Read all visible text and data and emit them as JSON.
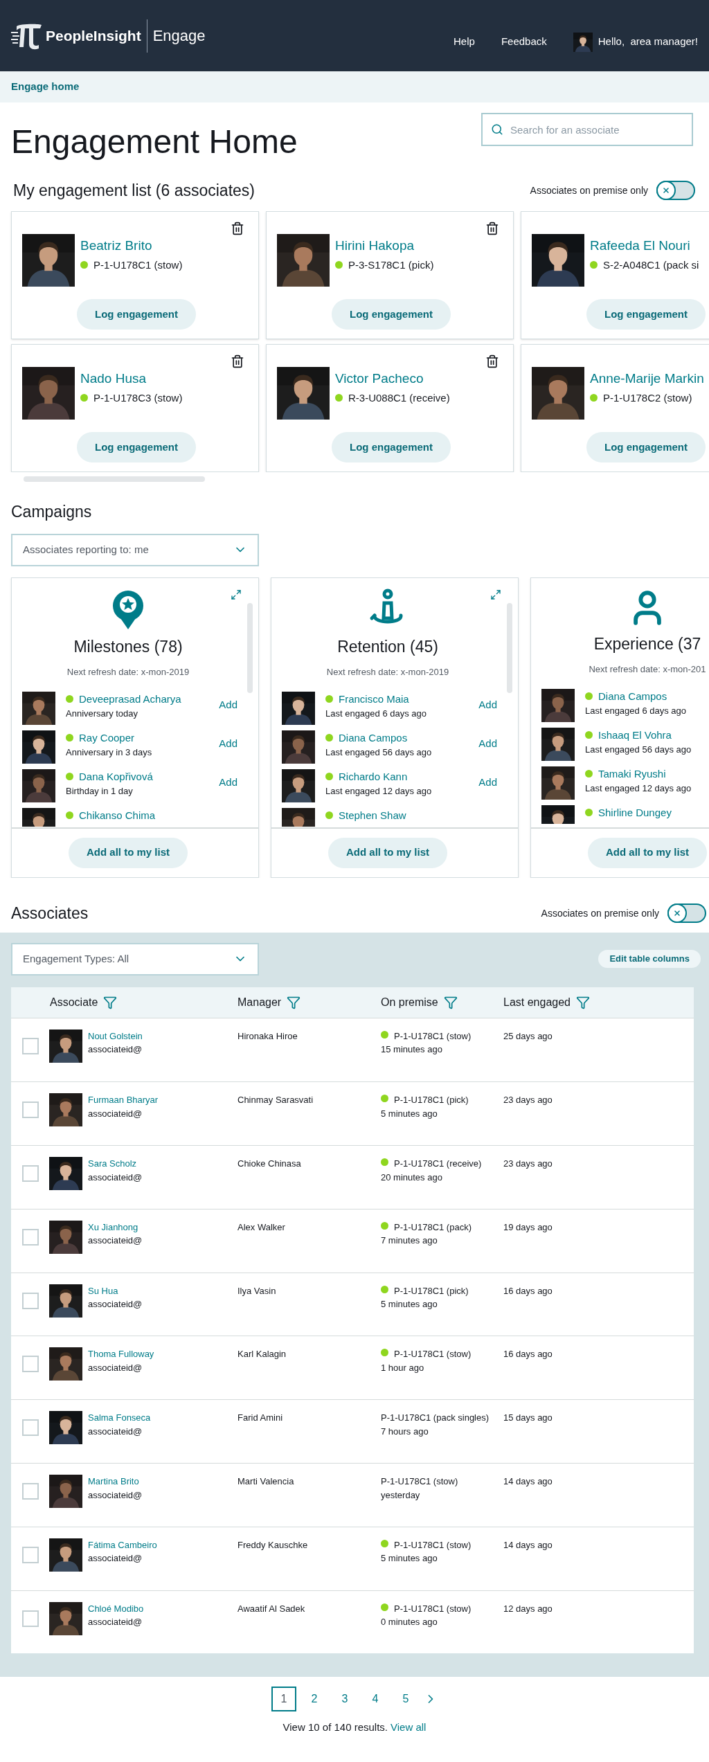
{
  "header": {
    "brand": "PeopleInsight",
    "product": "Engage",
    "nav": [
      "Help",
      "Feedback"
    ],
    "greeting": "Hello,  area manager!"
  },
  "breadcrumb": "Engage home",
  "title": "Engagement Home",
  "search": {
    "placeholder": "Search for an associate"
  },
  "engagement_list": {
    "heading": "My engagement list (6 associates)",
    "toggle": {
      "label": "Associates on premise only",
      "on": false
    },
    "cards": [
      {
        "name": "Beatriz Brito",
        "location": "P-1-U178C1 (stow)",
        "button": "Log engagement",
        "deletable": true
      },
      {
        "name": "Hirini Hakopa",
        "location": "P-3-S178C1 (pick)",
        "button": "Log engagement",
        "deletable": true
      },
      {
        "name": "Rafeeda El Nouri",
        "location": "S-2-A048C1 (pack si",
        "button": "Log engagement",
        "deletable": false
      },
      {
        "name": "Nado Husa",
        "location": "P-1-U178C3 (stow)",
        "button": "Log engagement",
        "deletable": true
      },
      {
        "name": "Victor Pacheco",
        "location": "R-3-U088C1 (receive)",
        "button": "Log engagement",
        "deletable": true
      },
      {
        "name": "Anne-Marije Markin",
        "location": "P-1-U178C2 (stow)",
        "button": "Log engagement",
        "deletable": false
      }
    ]
  },
  "campaigns": {
    "heading": "Campaigns",
    "filter": "Associates reporting to: me",
    "cards": [
      {
        "kind": "milestones",
        "title": "Milestones (78)",
        "refresh": "Next refresh date: x-mon-2019",
        "expandable": true,
        "button": "Add all to my list",
        "people": [
          {
            "name": "Deveeprasad Acharya",
            "note": "Anniversary today",
            "action": "Add"
          },
          {
            "name": "Ray Cooper",
            "note": "Anniversary in 3 days",
            "action": "Add"
          },
          {
            "name": "Dana Kopřivová",
            "note": "Birthday in 1 day",
            "action": "Add"
          },
          {
            "name": "Chikanso Chima"
          }
        ]
      },
      {
        "kind": "retention",
        "title": "Retention (45)",
        "refresh": "Next refresh date: x-mon-2019",
        "expandable": true,
        "button": "Add all to my list",
        "people": [
          {
            "name": "Francisco Maia",
            "note": "Last engaged 6 days ago",
            "action": "Add"
          },
          {
            "name": "Diana Campos",
            "note": "Last engaged 56 days ago",
            "action": "Add"
          },
          {
            "name": "Richardo Kann",
            "note": "Last engaged 12 days ago",
            "action": "Add"
          },
          {
            "name": "Stephen Shaw"
          }
        ]
      },
      {
        "kind": "experience",
        "title": "Experience (37",
        "refresh": "Next refresh date: x-mon-201",
        "expandable": false,
        "button": "Add all to my list",
        "people": [
          {
            "name": "Diana Campos",
            "note": "Last engaged 6 days ago"
          },
          {
            "name": "Ishaaq El Vohra",
            "note": "Last engaged 56 days ago"
          },
          {
            "name": "Tamaki Ryushi",
            "note": "Last engaged 12 days ago"
          },
          {
            "name": "Shirline Dungey"
          }
        ]
      }
    ]
  },
  "associates": {
    "heading": "Associates",
    "toggle": {
      "label": "Associates on premise only",
      "on": false
    },
    "filter": "Engagement Types: All",
    "edit_button": "Edit table columns",
    "columns": [
      "Associate",
      "Manager",
      "On premise",
      "Last engaged"
    ],
    "rows": [
      {
        "name": "Nout Golstein",
        "id": "associateid@",
        "manager": "Hironaka Hiroe",
        "location": "P-1-U178C1 (stow)",
        "seen": "15 minutes ago",
        "present": true,
        "last": "25 days ago",
        "checked": false
      },
      {
        "name": "Furmaan Bharyar",
        "id": "associateid@",
        "manager": "Chinmay Sarasvati",
        "location": "P-1-U178C1 (pick)",
        "seen": "5 minutes ago",
        "present": true,
        "last": "23 days ago",
        "checked": false
      },
      {
        "name": "Sara Scholz",
        "id": "associateid@",
        "manager": "Chioke Chinasa",
        "location": "P-1-U178C1 (receive)",
        "seen": "20 minutes ago",
        "present": true,
        "last": "23 days ago",
        "checked": false
      },
      {
        "name": "Xu Jianhong",
        "id": "associateid@",
        "manager": "Alex Walker",
        "location": "P-1-U178C1 (pack)",
        "seen": "7 minutes ago",
        "present": true,
        "last": "19 days ago",
        "checked": false
      },
      {
        "name": "Su Hua",
        "id": "associateid@",
        "manager": "Ilya Vasin",
        "location": "P-1-U178C1 (pick)",
        "seen": "5 minutes ago",
        "present": true,
        "last": "16 days ago",
        "checked": false
      },
      {
        "name": "Thoma Fulloway",
        "id": "associateid@",
        "manager": "Karl Kalagin",
        "location": "P-1-U178C1 (stow)",
        "seen": "1 hour ago",
        "present": true,
        "last": "16 days ago",
        "checked": false
      },
      {
        "name": "Salma Fonseca",
        "id": "associateid@",
        "manager": "Farid Amini",
        "location": "P-1-U178C1 (pack singles)",
        "seen": "7 hours ago",
        "present": false,
        "last": "15 days ago",
        "checked": false
      },
      {
        "name": "Martina Brito",
        "id": "associateid@",
        "manager": "Marti Valencia",
        "location": "P-1-U178C1 (stow)",
        "seen": "yesterday",
        "present": false,
        "last": "14 days ago",
        "checked": false
      },
      {
        "name": "Fátima Cambeiro",
        "id": "associateid@",
        "manager": "Freddy Kauschke",
        "location": "P-1-U178C1 (stow)",
        "seen": "5 minutes ago",
        "present": true,
        "last": "14 days ago",
        "checked": false
      },
      {
        "name": "Chloé Modibo",
        "id": "associateid@",
        "manager": "Awaatif Al Sadek",
        "location": "P-1-U178C1 (stow)",
        "seen": "0 minutes ago",
        "present": true,
        "last": "12 days ago",
        "checked": false
      }
    ]
  },
  "pagination": {
    "pages": [
      {
        "label": "1",
        "selected": true
      },
      {
        "label": "2",
        "selected": false
      },
      {
        "label": "3",
        "selected": false
      },
      {
        "label": "4",
        "selected": false
      },
      {
        "label": "5",
        "selected": false
      }
    ],
    "summary": "View 10 of 140 results.",
    "link": "View all"
  }
}
